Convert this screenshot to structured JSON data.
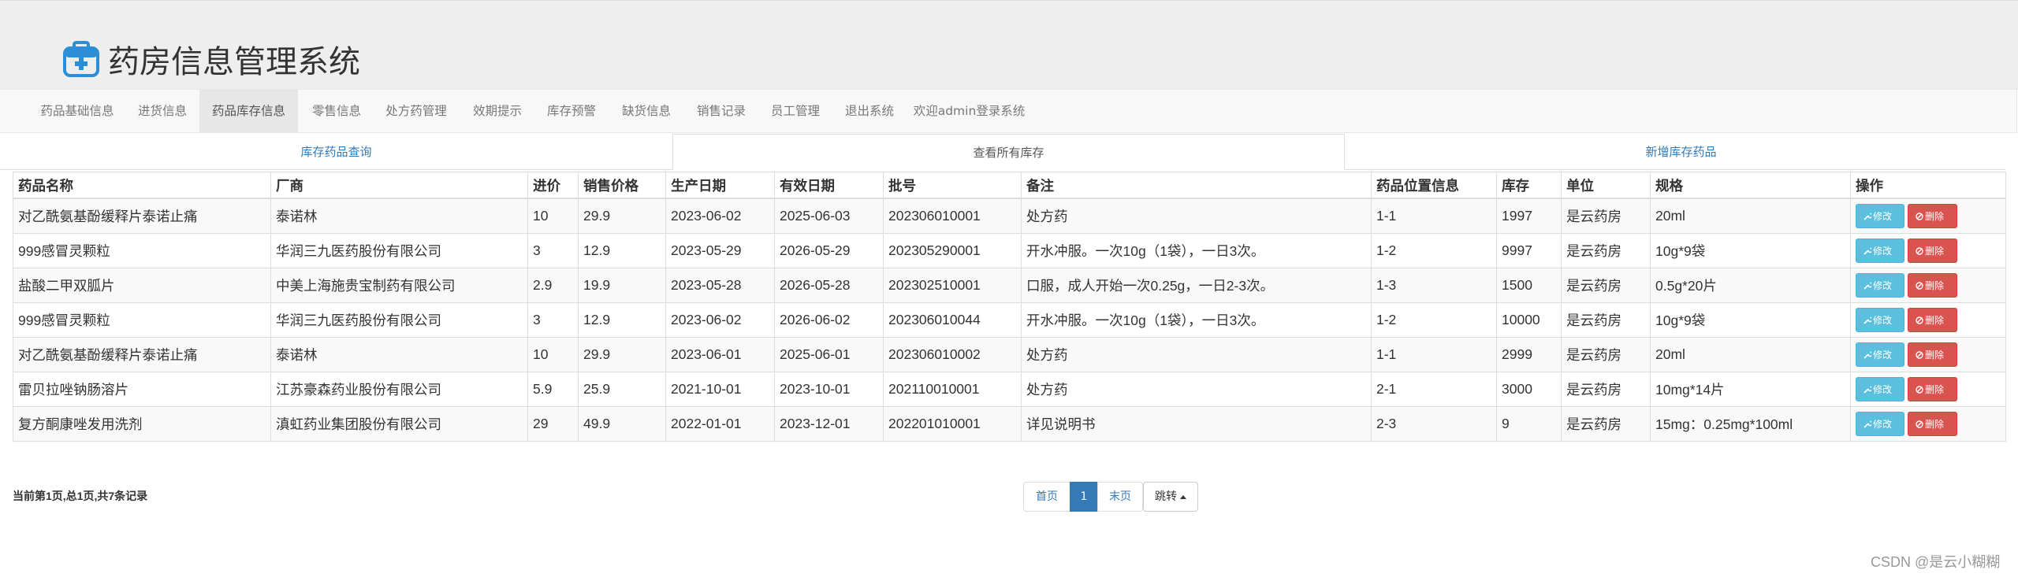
{
  "app": {
    "title": "药房信息管理系统",
    "brand_icon": "medicine-box-icon",
    "accent_color": "#2d8ed8"
  },
  "nav": {
    "items": [
      {
        "label": "药品基础信息"
      },
      {
        "label": "进货信息"
      },
      {
        "label": "药品库存信息",
        "active": true
      },
      {
        "label": "零售信息"
      },
      {
        "label": "处方药管理"
      },
      {
        "label": "效期提示"
      },
      {
        "label": "库存预警"
      },
      {
        "label": "缺货信息"
      },
      {
        "label": "销售记录"
      },
      {
        "label": "员工管理"
      },
      {
        "label": "退出系统"
      },
      {
        "label": "欢迎admin登录系统"
      }
    ]
  },
  "tabs": [
    {
      "label": "库存药品查询"
    },
    {
      "label": "查看所有库存",
      "active": true
    },
    {
      "label": "新增库存药品"
    }
  ],
  "table": {
    "headers": [
      "药品名称",
      "厂商",
      "进价",
      "销售价格",
      "生产日期",
      "有效日期",
      "批号",
      "备注",
      "药品位置信息",
      "库存",
      "单位",
      "规格",
      "操作"
    ],
    "rows": [
      [
        "对乙酰氨基酚缓释片泰诺止痛",
        "泰诺林",
        "10",
        "29.9",
        "2023-06-02",
        "2025-06-03",
        "202306010001",
        "处方药",
        "1-1",
        "1997",
        "是云药房",
        "20ml"
      ],
      [
        "999感冒灵颗粒",
        "华润三九医药股份有限公司",
        "3",
        "12.9",
        "2023-05-29",
        "2026-05-29",
        "202305290001",
        "开水冲服。一次10g（1袋），一日3次。",
        "1-2",
        "9997",
        "是云药房",
        "10g*9袋"
      ],
      [
        "盐酸二甲双胍片",
        "中美上海施贵宝制药有限公司",
        "2.9",
        "19.9",
        "2023-05-28",
        "2026-05-28",
        "202302510001",
        "口服，成人开始一次0.25g，一日2-3次。",
        "1-3",
        "1500",
        "是云药房",
        "0.5g*20片"
      ],
      [
        "999感冒灵颗粒",
        "华润三九医药股份有限公司",
        "3",
        "12.9",
        "2023-06-02",
        "2026-06-02",
        "202306010044",
        "开水冲服。一次10g（1袋），一日3次。",
        "1-2",
        "10000",
        "是云药房",
        "10g*9袋"
      ],
      [
        "对乙酰氨基酚缓释片泰诺止痛",
        "泰诺林",
        "10",
        "29.9",
        "2023-06-01",
        "2025-06-01",
        "202306010002",
        "处方药",
        "1-1",
        "2999",
        "是云药房",
        "20ml"
      ],
      [
        "雷贝拉唑钠肠溶片",
        "江苏豪森药业股份有限公司",
        "5.9",
        "25.9",
        "2021-10-01",
        "2023-10-01",
        "202110010001",
        "处方药",
        "2-1",
        "3000",
        "是云药房",
        "10mg*14片"
      ],
      [
        "复方酮康唑发用洗剂",
        "滇虹药业集团股份有限公司",
        "29",
        "49.9",
        "2022-01-01",
        "2023-12-01",
        "202201010001",
        "详见说明书",
        "2-3",
        "9",
        "是云药房",
        "15mg：0.25mg*100ml"
      ]
    ],
    "edit_label": "修改",
    "delete_label": "删除",
    "edit_icon": "wrench-icon",
    "delete_icon": "ban-icon"
  },
  "footer": {
    "page_info": "当前第1页,总1页,共7条记录",
    "pager": {
      "first": "首页",
      "current": "1",
      "last": "末页",
      "jump": "跳转"
    }
  },
  "watermark": "CSDN @是云小糊糊",
  "colors": {
    "header_bg": "#eeeeee",
    "navbar_bg": "#f8f8f8",
    "link": "#337ab7",
    "info": "#5bc0de",
    "danger": "#d9534f"
  }
}
